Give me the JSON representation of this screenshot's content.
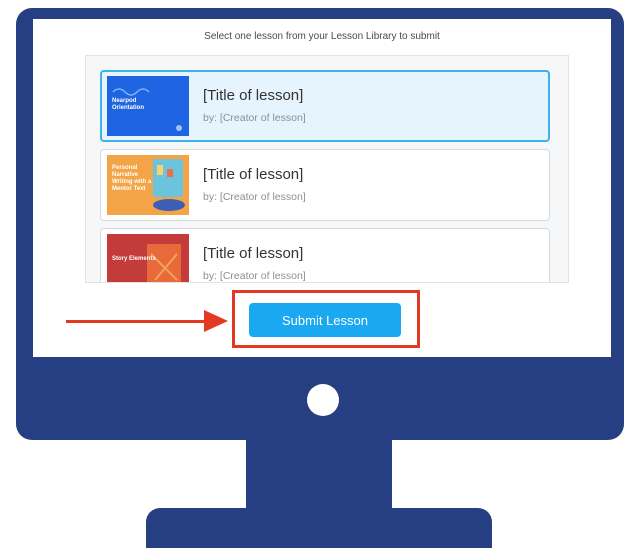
{
  "instruction": "Select one lesson from your Lesson Library to submit",
  "lessons": [
    {
      "title": "[Title of lesson]",
      "creator": "by: [Creator of lesson]",
      "thumbnail_text": "Nearpod Orientation",
      "selected": true
    },
    {
      "title": "[Title of lesson]",
      "creator": "by: [Creator of lesson]",
      "thumbnail_text": "Personal Narrative Writing with a Mentor Text",
      "selected": false
    },
    {
      "title": "[Title of lesson]",
      "creator": "by: [Creator of lesson]",
      "thumbnail_text": "Story Elements",
      "selected": false
    }
  ],
  "submit_button_label": "Submit Lesson",
  "colors": {
    "monitor": "#253f82",
    "accent": "#1aa9f1",
    "selected_border": "#3fb1ea",
    "annotation": "#e23a22"
  },
  "icons": {
    "arrow": "arrow-right-icon",
    "power": "power-button-icon"
  }
}
